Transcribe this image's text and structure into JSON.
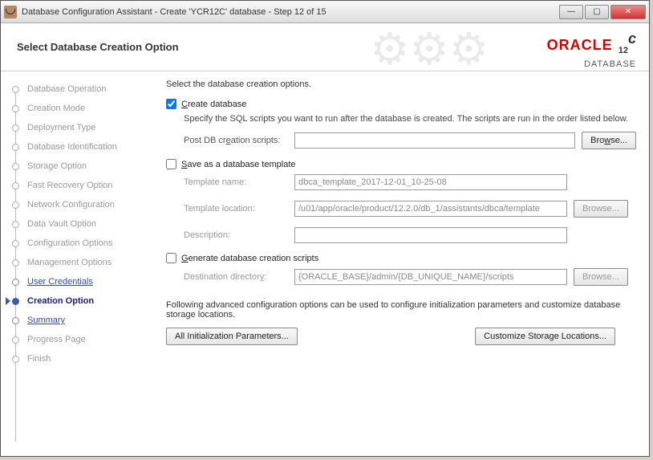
{
  "window": {
    "title": "Database Configuration Assistant - Create 'YCR12C' database - Step 12 of 15"
  },
  "header": {
    "title": "Select Database Creation Option",
    "brand_word": "ORACLE",
    "brand_sub": "DATABASE",
    "version": "12",
    "version_suffix": "c"
  },
  "sidebar": {
    "items": [
      {
        "label": "Database Operation",
        "state": "past"
      },
      {
        "label": "Creation Mode",
        "state": "past"
      },
      {
        "label": "Deployment Type",
        "state": "past"
      },
      {
        "label": "Database Identification",
        "state": "past"
      },
      {
        "label": "Storage Option",
        "state": "past"
      },
      {
        "label": "Fast Recovery Option",
        "state": "past"
      },
      {
        "label": "Network Configuration",
        "state": "past"
      },
      {
        "label": "Data Vault Option",
        "state": "past"
      },
      {
        "label": "Configuration Options",
        "state": "past"
      },
      {
        "label": "Management Options",
        "state": "past"
      },
      {
        "label": "User Credentials",
        "state": "link"
      },
      {
        "label": "Creation Option",
        "state": "current"
      },
      {
        "label": "Summary",
        "state": "link"
      },
      {
        "label": "Progress Page",
        "state": "past"
      },
      {
        "label": "Finish",
        "state": "past"
      }
    ]
  },
  "main": {
    "intro": "Select the database creation options.",
    "create_db": {
      "label": "Create database",
      "checked": true
    },
    "create_desc": "Specify the SQL scripts you want to run after the database is created. The scripts are run in the order listed below.",
    "post_scripts_label": "Post DB creation scripts:",
    "post_scripts_value": "",
    "browse_label": "Browse...",
    "save_tmpl": {
      "label": "Save as a database template",
      "checked": false
    },
    "tmpl_name_label": "Template name:",
    "tmpl_name_value": "dbca_template_2017-12-01_10-25-08",
    "tmpl_loc_label": "Template location:",
    "tmpl_loc_value": "/u01/app/oracle/product/12.2.0/db_1/assistants/dbca/template",
    "tmpl_desc_label": "Description:",
    "tmpl_desc_value": "",
    "gen_scripts": {
      "label": "Generate database creation scripts",
      "checked": false
    },
    "dest_dir_label": "Destination directory:",
    "dest_dir_value": "{ORACLE_BASE}/admin/{DB_UNIQUE_NAME}/scripts",
    "adv_text": "Following advanced configuration options can be used to configure initialization parameters and customize database storage locations.",
    "btn_init": "All Initialization Parameters...",
    "btn_storage": "Customize Storage Locations..."
  }
}
